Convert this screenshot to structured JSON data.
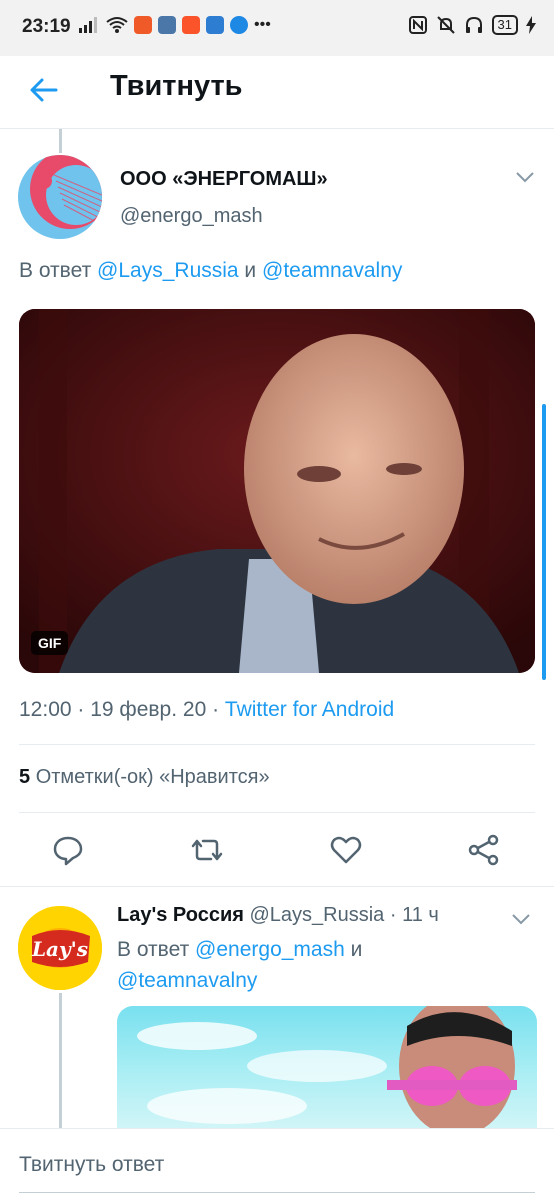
{
  "status_bar": {
    "time": "23:19",
    "battery": "31"
  },
  "header": {
    "title": "Твитнуть"
  },
  "tweet": {
    "name": "ООО «ЭНЕРГОМАШ»",
    "handle": "@energo_mash",
    "reply_prefix": "В ответ ",
    "reply_to_1": "@Lays_Russia",
    "reply_and": " и ",
    "reply_to_2": "@teamnavalny",
    "media_badge": "GIF",
    "time": "12:00",
    "date": "19 февр. 20",
    "source": "Twitter for Android",
    "likes_count": "5",
    "likes_label": "Отметки(-ок) «Нравится»"
  },
  "reply_tweet": {
    "name": "Lay's Россия",
    "handle": "@Lays_Russia",
    "age": "11 ч",
    "reply_prefix": "В ответ ",
    "reply_to_1": "@energo_mash",
    "reply_and": " и ",
    "reply_to_2": "@teamnavalny",
    "avatar_text": "Lay's"
  },
  "composer": {
    "placeholder": "Твитнуть ответ"
  },
  "colors": {
    "accent": "#1d9bf0",
    "secondary_text": "#536471",
    "divider": "#e6ecf0"
  }
}
